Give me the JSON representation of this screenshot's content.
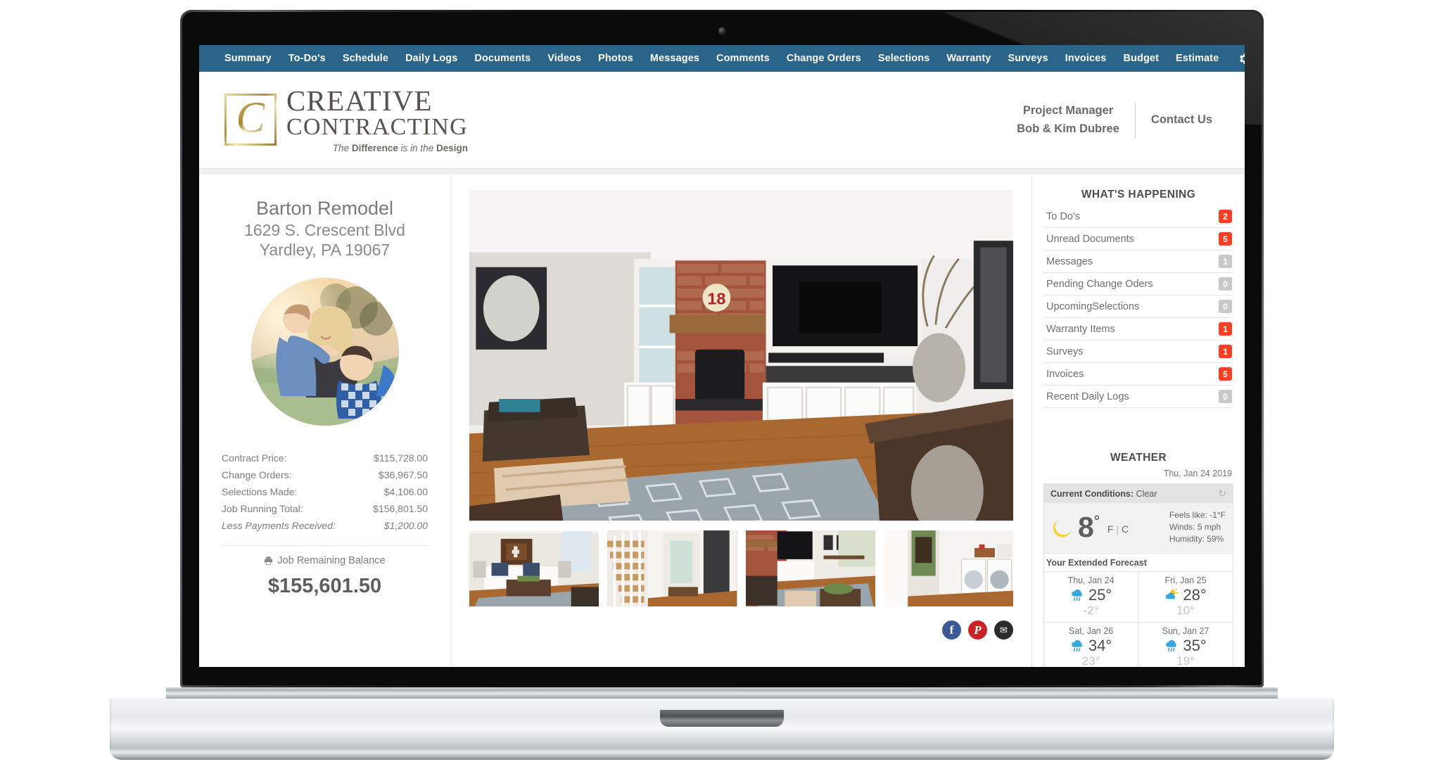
{
  "nav": {
    "items": [
      "Summary",
      "To-Do's",
      "Schedule",
      "Daily Logs",
      "Documents",
      "Videos",
      "Photos",
      "Messages",
      "Comments",
      "Change Orders",
      "Selections",
      "Warranty",
      "Surveys",
      "Invoices",
      "Budget",
      "Estimate"
    ],
    "settings_icon": "gear-icon",
    "bg_color": "#2a6488"
  },
  "brand": {
    "monogram": "C",
    "line1": "CREATIVE",
    "line2": "CONTRACTING",
    "tagline_pre": "The ",
    "tagline_b1": "Difference",
    "tagline_mid": " is in the ",
    "tagline_b2": "Design"
  },
  "header": {
    "pm_label": "Project Manager",
    "pm_name": "Bob & Kim Dubree",
    "contact": "Contact Us"
  },
  "project": {
    "name": "Barton Remodel",
    "address_line1": "1629 S. Crescent Blvd",
    "address_line2": "Yardley, PA 19067",
    "financials": [
      {
        "label": "Contract Price:",
        "value": "$115,728.00",
        "italic": false
      },
      {
        "label": "Change Orders:",
        "value": "$36,967.50",
        "italic": false
      },
      {
        "label": "Selections Made:",
        "value": "$4,106.00",
        "italic": false
      },
      {
        "label": "Job Running Total:",
        "value": "$156,801.50",
        "italic": false
      },
      {
        "label": "Less Payments Received:",
        "value": "$1,200.00",
        "italic": true
      }
    ],
    "balance_label": "Job Remaining Balance",
    "balance_icon": "printer-icon",
    "balance_value": "$155,601.50"
  },
  "gallery": {
    "hero_alt": "living-room-fireplace-photo",
    "thumbs": [
      "living-room-sofa-photo",
      "staircase-hallway-photo",
      "family-room-photo",
      "laundry-room-photo"
    ],
    "social": [
      {
        "name": "facebook-share-button",
        "glyph": "f",
        "color": "#3b5998"
      },
      {
        "name": "pinterest-share-button",
        "glyph": "P",
        "color": "#c92228"
      },
      {
        "name": "email-share-button",
        "glyph": "✉",
        "color": "#2b2b2b"
      }
    ]
  },
  "whats_happening": {
    "title": "WHAT'S HAPPENING",
    "rows": [
      {
        "label": "To Do's",
        "count": "2",
        "hot": true
      },
      {
        "label": "Unread Documents",
        "count": "5",
        "hot": true
      },
      {
        "label": "Messages",
        "count": "1",
        "hot": false
      },
      {
        "label": "Pending Change Oders",
        "count": "0",
        "hot": false
      },
      {
        "label": "UpcomingSelections",
        "count": "0",
        "hot": false
      },
      {
        "label": "Warranty Items",
        "count": "1",
        "hot": true
      },
      {
        "label": "Surveys",
        "count": "1",
        "hot": true
      },
      {
        "label": "Invoices",
        "count": "5",
        "hot": true
      },
      {
        "label": "Recent Daily Logs",
        "count": "0",
        "hot": false
      }
    ],
    "badge_hot_color": "#f04124",
    "badge_zero_color": "#c9c9c9"
  },
  "weather": {
    "title": "WEATHER",
    "date": "Thu, Jan 24 2019",
    "conditions_label": "Current Conditions:",
    "conditions_value": "Clear",
    "refresh_icon": "refresh-icon",
    "current_icon": "moon-icon",
    "temp": "8",
    "degree": "°",
    "unit_f": "F",
    "unit_sep": "|",
    "unit_c": "C",
    "feels_like": "Feels like: -1°F",
    "winds": "Winds: 5 mph",
    "humidity": "Humidity: 59%",
    "extended_title": "Your Extended Forecast",
    "forecast": [
      {
        "day": "Thu, Jan 24",
        "icon": "rain-cloud-icon",
        "high": "25°",
        "low": "-2°"
      },
      {
        "day": "Fri, Jan 25",
        "icon": "sun-cloud-icon",
        "high": "28°",
        "low": "10°"
      },
      {
        "day": "Sat, Jan 26",
        "icon": "rain-cloud-icon",
        "high": "34°",
        "low": "23°"
      },
      {
        "day": "Sun, Jan 27",
        "icon": "rain-cloud-icon",
        "high": "35°",
        "low": "19°"
      }
    ]
  }
}
